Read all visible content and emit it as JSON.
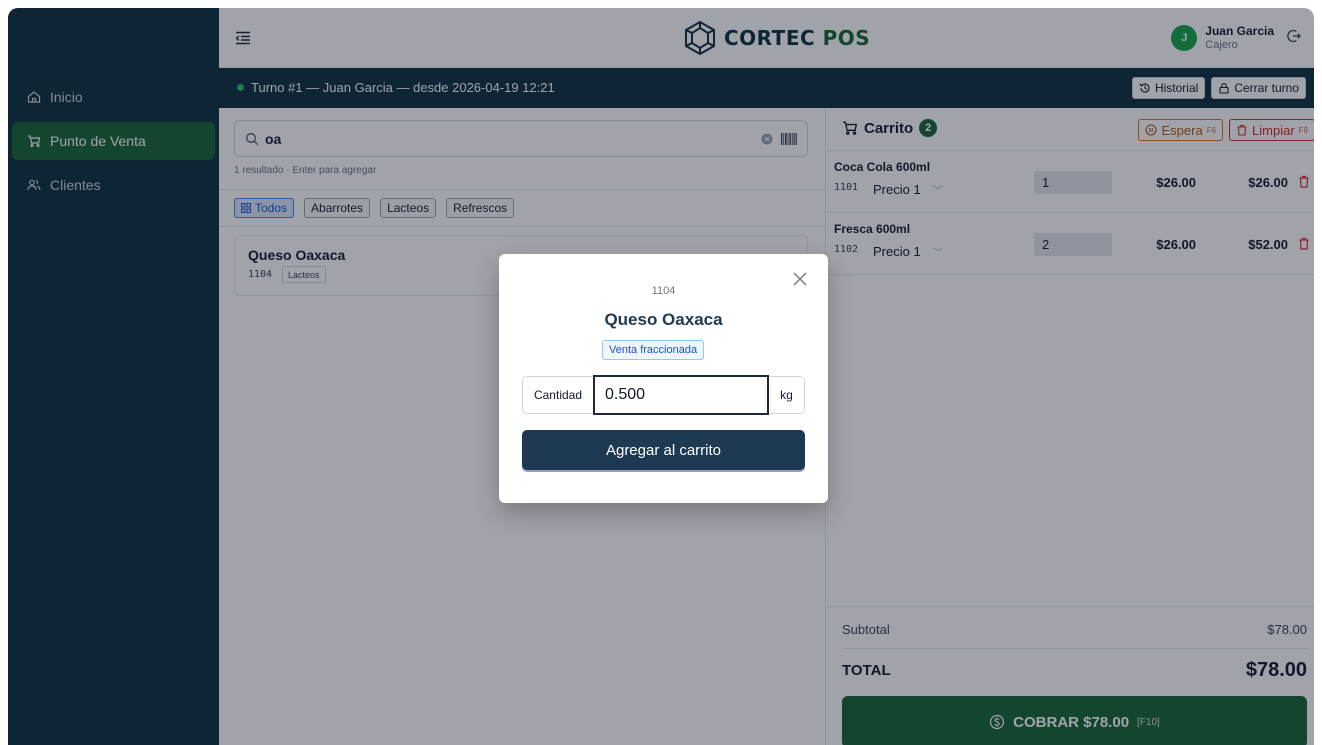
{
  "app": {
    "logo_text_primary": "CORTEC ",
    "logo_text_secondary": "POS"
  },
  "user": {
    "initial": "J",
    "name": "Juan Garcia",
    "role": "Cajero"
  },
  "sidebar": {
    "items": [
      {
        "label": "Inicio",
        "icon": "home-icon",
        "active": false
      },
      {
        "label": "Punto de Venta",
        "icon": "cart-icon",
        "active": true
      },
      {
        "label": "Clientes",
        "icon": "users-icon",
        "active": false
      }
    ]
  },
  "shift": {
    "text": "Turno #1 — Juan Garcia — desde 2026-04-19 12:21",
    "history_label": "Historial",
    "close_label": "Cerrar turno"
  },
  "search": {
    "value": "oa",
    "hint": "1 resultado · Enter para agregar"
  },
  "categories": [
    "Todos",
    "Abarrotes",
    "Lacteos",
    "Refrescos"
  ],
  "products": [
    {
      "name": "Queso Oaxaca",
      "code": "1104",
      "category": "Lacteos"
    }
  ],
  "cart": {
    "title": "Carrito",
    "count": "2",
    "wait_label": "Espera",
    "wait_key": "F6",
    "clear_label": "Limpiar",
    "clear_key": "F9",
    "items": [
      {
        "name": "Coca Cola 600ml",
        "code": "1101",
        "price_list": "Precio 1",
        "qty": "1",
        "unit_price": "$26.00",
        "subtotal": "$26.00"
      },
      {
        "name": "Fresca 600ml",
        "code": "1102",
        "price_list": "Precio 1",
        "qty": "2",
        "unit_price": "$26.00",
        "subtotal": "$52.00"
      }
    ],
    "subtotal_label": "Subtotal",
    "subtotal_value": "$78.00",
    "total_label": "TOTAL",
    "total_value": "$78.00",
    "charge_label": "COBRAR $78.00",
    "charge_key": "[F10]"
  },
  "modal": {
    "code": "1104",
    "name": "Queso Oaxaca",
    "badge": "Venta fraccionada",
    "qty_label": "Cantidad",
    "qty_value": "0.500",
    "unit": "kg",
    "add_label": "Agregar al carrito"
  },
  "colors": {
    "sidebar_bg": "#0c2d3f",
    "accent_green": "#166534",
    "primary_button": "#1e3a52",
    "danger": "#dc2626",
    "warning": "#d97706"
  }
}
